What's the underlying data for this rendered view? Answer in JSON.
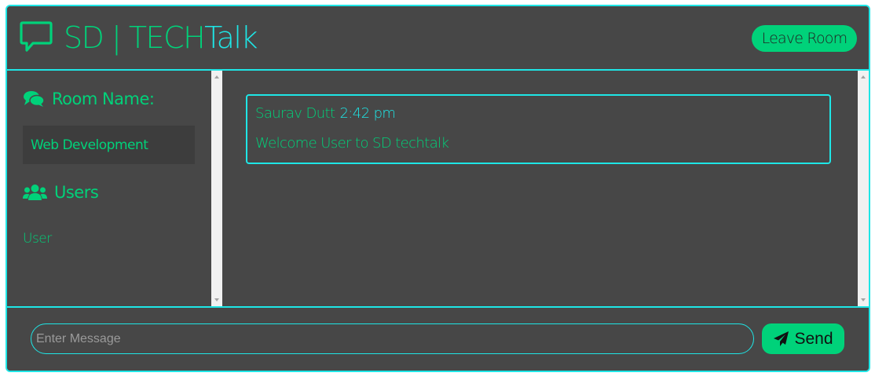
{
  "header": {
    "logo_icon": "chat-bubble-icon",
    "title_main": "SD | TECH",
    "title_accent": "Talk",
    "leave_button": "Leave Room"
  },
  "sidebar": {
    "room_heading": "Room Name:",
    "room_icon": "comments-icon",
    "room_name": "Web Development",
    "users_heading": "Users",
    "users_icon": "users-icon",
    "users": [
      "User"
    ]
  },
  "messages": [
    {
      "author": "Saurav Dutt",
      "time": "2:42 pm",
      "text": "Welcome User to SD techtalk"
    }
  ],
  "composer": {
    "placeholder": "Enter Message",
    "value": "",
    "send_label": "Send",
    "send_icon": "paper-plane-icon"
  },
  "colors": {
    "accent_green": "#00d27a",
    "accent_cyan": "#1ee6e6",
    "panel_bg": "#474747"
  }
}
